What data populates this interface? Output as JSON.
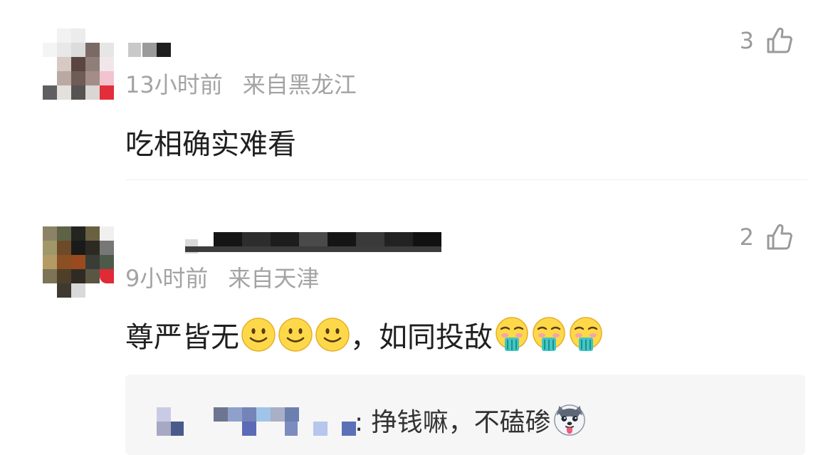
{
  "comments": [
    {
      "time": "13小时前",
      "location": "来自黑龙江",
      "text": "吃相确实难看",
      "likes": "3"
    },
    {
      "time": "9小时前",
      "location": "来自天津",
      "text_before": "尊严皆无",
      "text_after": "，如同投敌",
      "likes": "2",
      "reply": {
        "text": ": 挣钱嘛，不磕碜"
      }
    }
  ],
  "icons": {
    "like": "thumbs-up-icon",
    "emoji_smile": "slightly-smiling-emoji",
    "emoji_puke": "puking-face-emoji",
    "emoji_husky": "husky-dog-emoji"
  }
}
